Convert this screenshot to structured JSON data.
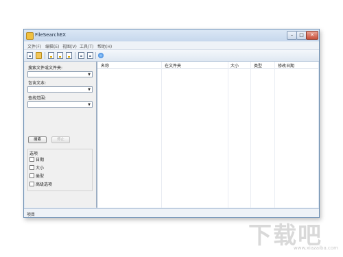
{
  "window": {
    "title": "FileSearchEX"
  },
  "menu": [
    "文件(F)",
    "编辑(E)",
    "视图(V)",
    "工具(T)",
    "帮助(H)"
  ],
  "left_panel": {
    "search_label": "搜索文件或文件夹:",
    "search_value": "",
    "content_label": "包含文本:",
    "content_value": "",
    "scope_label": "查找范围:",
    "scope_value": "",
    "search_button": "搜索",
    "stop_button": "停止",
    "options_title": "选项",
    "options": [
      "日期",
      "大小",
      "类型",
      "高级选项"
    ]
  },
  "columns": [
    "名称",
    "在文件夹",
    "大小",
    "类型",
    "修改日期"
  ],
  "status": {
    "text": "项目"
  },
  "watermark": {
    "logo": "下载吧",
    "sub": "www.xiazaiba.com"
  }
}
